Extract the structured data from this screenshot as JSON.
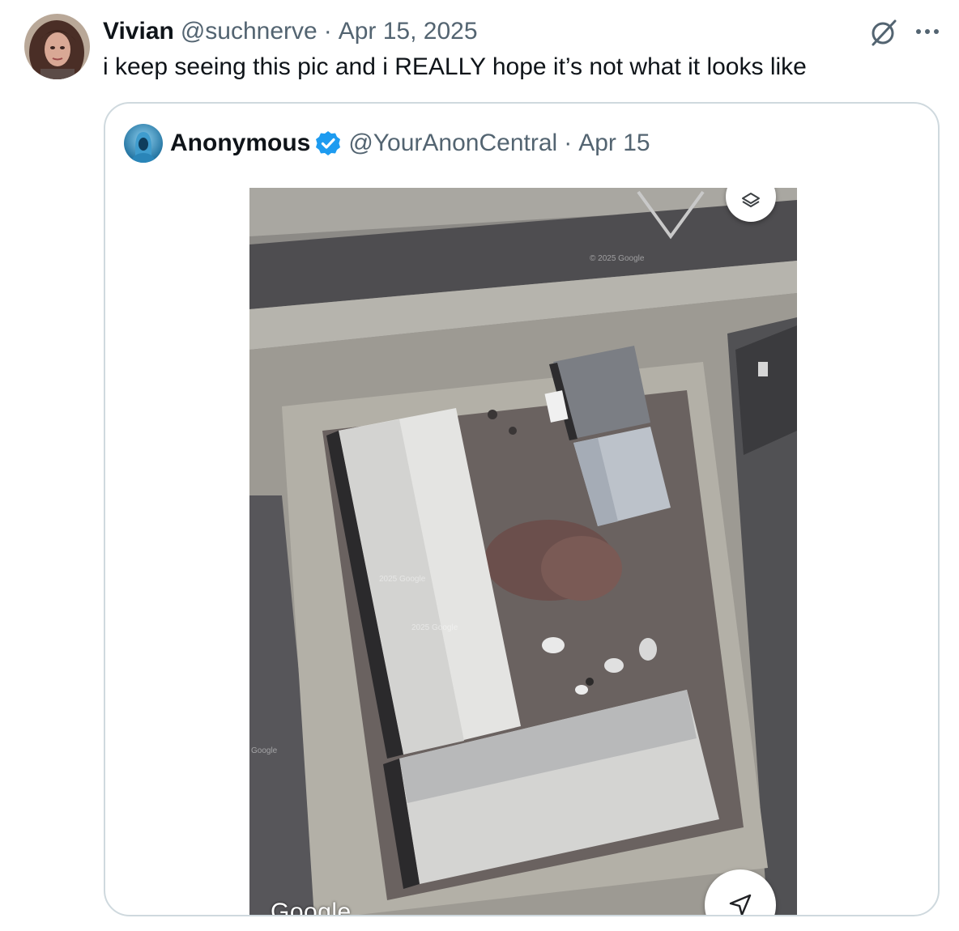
{
  "tweet": {
    "author": {
      "display_name": "Vivian",
      "handle": "@suchnerve"
    },
    "separator": "·",
    "date": "Apr 15, 2025",
    "text": "i keep seeing this pic and i REALLY hope it’s not what it looks like",
    "icons": {
      "grok": "grok-icon",
      "more": "more-icon"
    }
  },
  "quoted_tweet": {
    "author": {
      "display_name": "Anonymous",
      "handle": "@YourAnonCentral",
      "verified": true
    },
    "separator": "·",
    "date": "Apr 15",
    "media": {
      "kind": "satellite-map",
      "logo_text": "Google",
      "watermark": "© 2025 Google",
      "watermark_short": "2025 Google",
      "watermark_tiny": "Google",
      "controls": [
        "layers-icon",
        "navigation-arrow-icon"
      ]
    }
  },
  "colors": {
    "text_primary": "#0f1419",
    "text_muted": "#536471",
    "border": "#cfd9de",
    "verified_blue": "#1d9bf0"
  }
}
